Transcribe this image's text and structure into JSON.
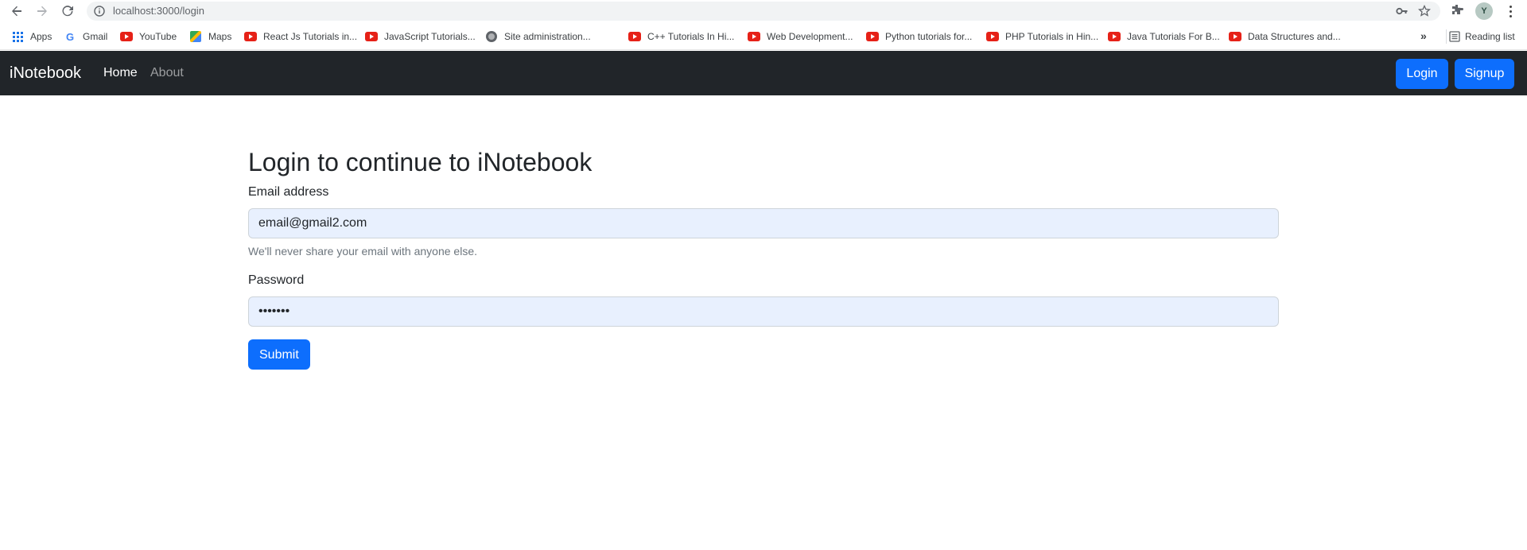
{
  "browser": {
    "url": "localhost:3000/login",
    "back_icon": "back-arrow-icon",
    "forward_icon": "forward-arrow-icon",
    "reload_icon": "reload-icon",
    "profile_initial": "Y"
  },
  "bookmarks": {
    "items": [
      {
        "label": "Apps",
        "icon": "apps-grid-icon"
      },
      {
        "label": "Gmail",
        "icon": "google-icon"
      },
      {
        "label": "YouTube",
        "icon": "youtube-icon"
      },
      {
        "label": "Maps",
        "icon": "maps-icon"
      },
      {
        "label": "React Js Tutorials in...",
        "icon": "youtube-icon"
      },
      {
        "label": "JavaScript Tutorials...",
        "icon": "youtube-icon"
      },
      {
        "label": "Site administration...",
        "icon": "globe-icon"
      },
      {
        "label": "C++ Tutorials In Hi...",
        "icon": "youtube-icon"
      },
      {
        "label": "Web Development...",
        "icon": "youtube-icon"
      },
      {
        "label": "Python tutorials for...",
        "icon": "youtube-icon"
      },
      {
        "label": "PHP Tutorials in Hin...",
        "icon": "youtube-icon"
      },
      {
        "label": "Java Tutorials For B...",
        "icon": "youtube-icon"
      },
      {
        "label": "Data Structures and...",
        "icon": "youtube-icon"
      }
    ],
    "overflow": "»",
    "reading_list": "Reading list"
  },
  "navbar": {
    "brand": "iNotebook",
    "links": [
      {
        "label": "Home"
      },
      {
        "label": "About"
      }
    ],
    "login_button": "Login",
    "signup_button": "Signup",
    "accent_color": "#0d6efd",
    "background_color": "#212529"
  },
  "form": {
    "title": "Login to continue to iNotebook",
    "email_label": "Email address",
    "email_value": "email@gmail2.com",
    "email_help": "We'll never share your email with anyone else.",
    "password_label": "Password",
    "password_value": "•••••••",
    "submit_label": "Submit"
  }
}
